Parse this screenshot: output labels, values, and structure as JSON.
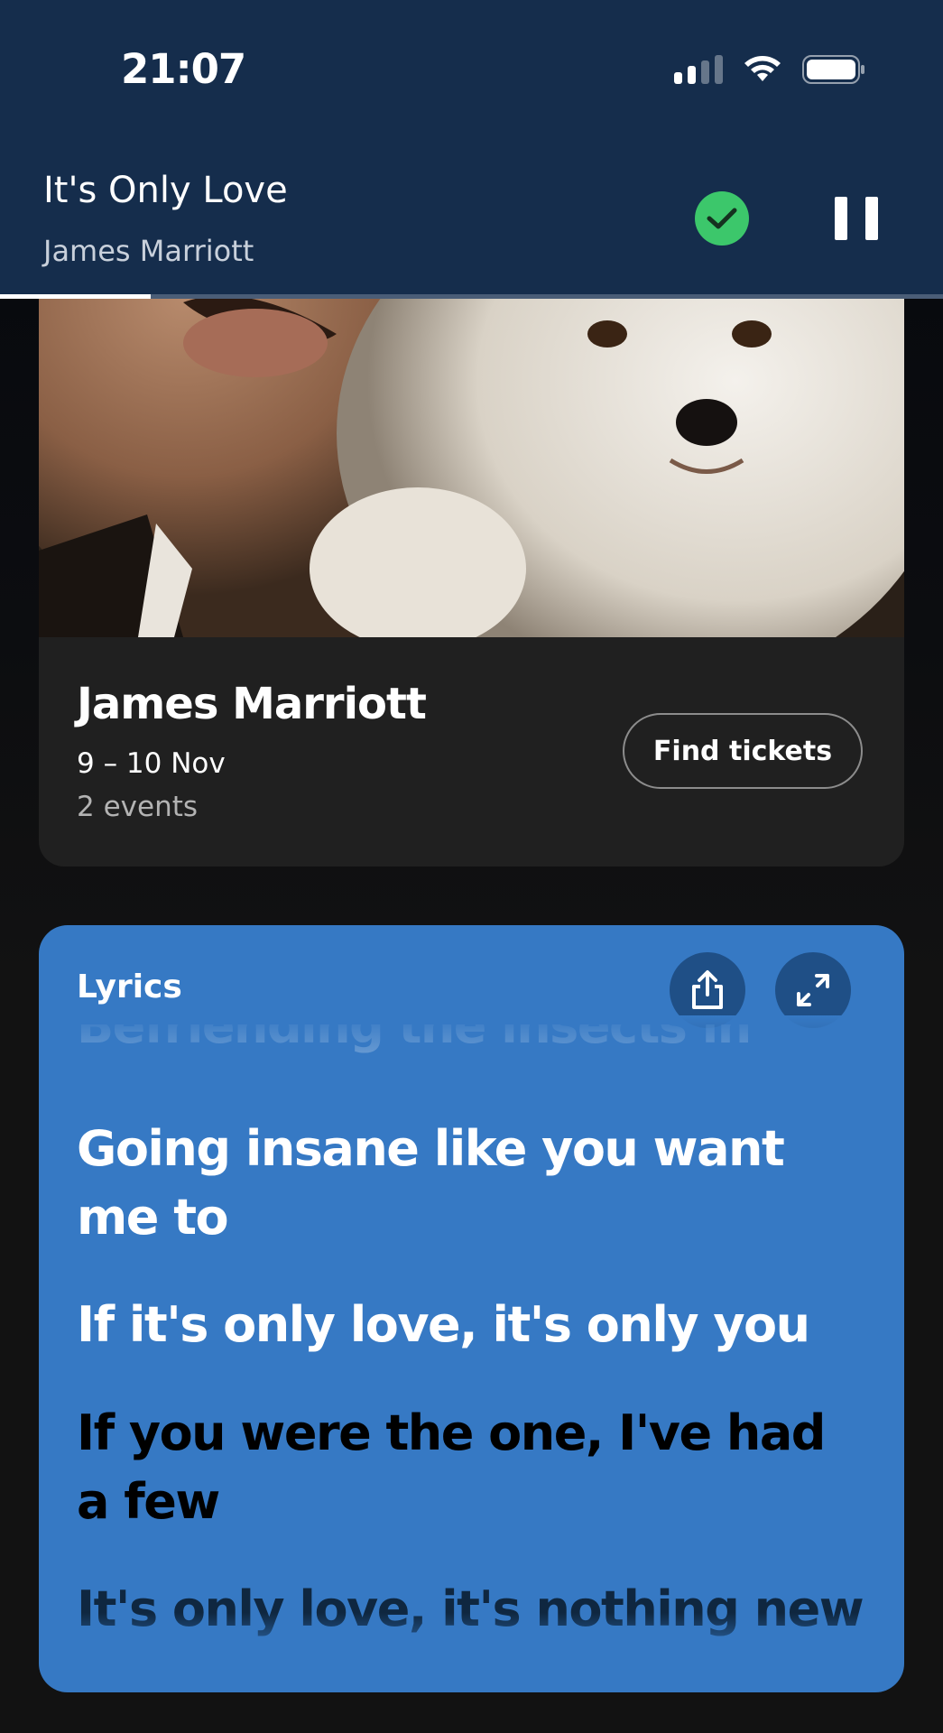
{
  "status_bar": {
    "time": "21:07",
    "icons": [
      "signal-icon",
      "wifi-icon",
      "battery-icon"
    ]
  },
  "now_playing": {
    "title": "It's Only Love",
    "artist": "James Marriott",
    "saved_icon": "check-circle-icon",
    "play_state_icon": "pause-icon",
    "progress_fraction": 0.16,
    "colors": {
      "header_bg": "#152d4c",
      "saved_badge": "#3cc76b"
    }
  },
  "tour": {
    "artist": "James Marriott",
    "dates": "9 – 10 Nov",
    "events": "2 events",
    "button_label": "Find tickets"
  },
  "lyrics": {
    "heading": "Lyrics",
    "share_icon": "share-icon",
    "expand_icon": "expand-icon",
    "color_bg": "#3679c4",
    "lines": {
      "faded": "Befriending the insects in here",
      "past_1": "Going insane like you want me to",
      "past_2": "If it's only love, it's only you",
      "current": "If you were the one, I've had a few",
      "next": "It's only love, it's nothing new"
    }
  }
}
